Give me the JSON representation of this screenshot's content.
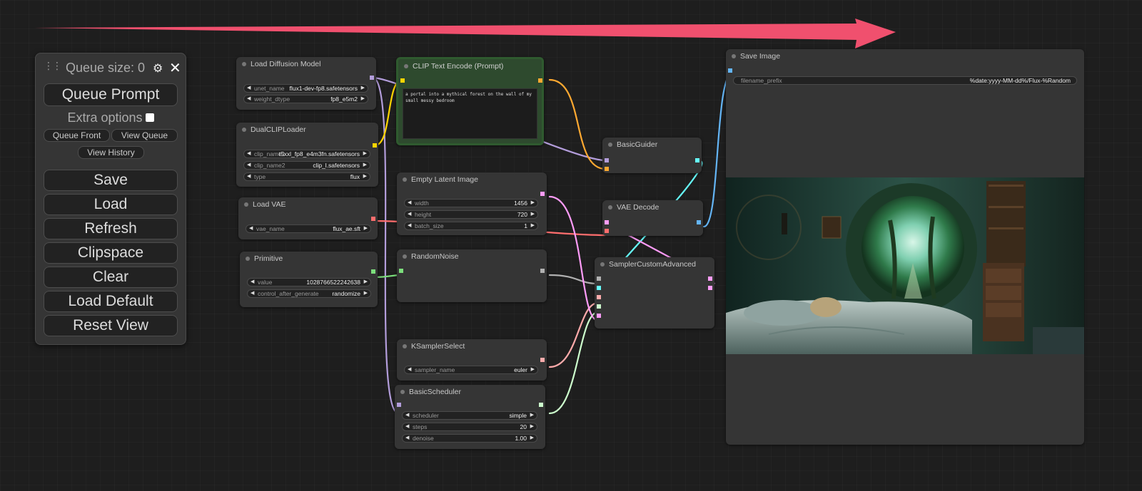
{
  "menu": {
    "queue_size": "Queue size: 0",
    "queue_prompt": "Queue Prompt",
    "extra_options": "Extra options",
    "queue_front": "Queue Front",
    "view_queue": "View Queue",
    "view_history": "View History",
    "save": "Save",
    "load": "Load",
    "refresh": "Refresh",
    "clipspace": "Clipspace",
    "clear": "Clear",
    "load_default": "Load Default",
    "reset_view": "Reset View"
  },
  "nodes": {
    "load_diffusion": {
      "title": "Load Diffusion Model",
      "w0_label": "unet_name",
      "w0_value": "flux1-dev-fp8.safetensors",
      "w1_label": "weight_dtype",
      "w1_value": "fp8_e5m2"
    },
    "dualclip": {
      "title": "DualCLIPLoader",
      "w0_label": "clip_name1",
      "w0_value": "t5xxl_fp8_e4m3fn.safetensors",
      "w1_label": "clip_name2",
      "w1_value": "clip_l.safetensors",
      "w2_label": "type",
      "w2_value": "flux"
    },
    "load_vae": {
      "title": "Load VAE",
      "w0_label": "vae_name",
      "w0_value": "flux_ae.sft"
    },
    "primitive": {
      "title": "Primitive",
      "w0_label": "value",
      "w0_value": "1028766522242638",
      "w1_label": "control_after_generate",
      "w1_value": "randomize"
    },
    "clip_text": {
      "title": "CLIP Text Encode (Prompt)",
      "prompt": "a portal into a mythical forest on the wall of my small messy bedroom"
    },
    "empty_latent": {
      "title": "Empty Latent Image",
      "w0_label": "width",
      "w0_value": "1456",
      "w1_label": "height",
      "w1_value": "720",
      "w2_label": "batch_size",
      "w2_value": "1"
    },
    "random_noise": {
      "title": "RandomNoise"
    },
    "ksampler_select": {
      "title": "KSamplerSelect",
      "w0_label": "sampler_name",
      "w0_value": "euler"
    },
    "basic_scheduler": {
      "title": "BasicScheduler",
      "w0_label": "scheduler",
      "w0_value": "simple",
      "w1_label": "steps",
      "w1_value": "20",
      "w2_label": "denoise",
      "w2_value": "1.00"
    },
    "basic_guider": {
      "title": "BasicGuider"
    },
    "vae_decode": {
      "title": "VAE Decode"
    },
    "sampler_custom": {
      "title": "SamplerCustomAdvanced"
    },
    "save_image": {
      "title": "Save Image",
      "w0_label": "filename_prefix",
      "w0_value": "%date:yyyy-MM-dd%/Flux-%Random"
    }
  },
  "colors": {
    "model": "#b39ddb",
    "clip": "#ffd500",
    "vae": "#ff6e6e",
    "int": "#7cde7c",
    "noise": "#b0b0b0",
    "latent": "#ff9cf9",
    "conditioning": "#ffa931",
    "image": "#64b5f6",
    "guider": "#66ffff",
    "sampler": "#ffabab",
    "sigmas": "#cdffcd",
    "arrow": "#f0506e",
    "clip_node": "#2e4a2e"
  },
  "icons": {
    "drag": "drag-handle-icon",
    "gear": "gear-icon",
    "close": "close-icon",
    "arrow_left": "arrow-left-icon",
    "arrow_right": "arrow-right-icon"
  }
}
